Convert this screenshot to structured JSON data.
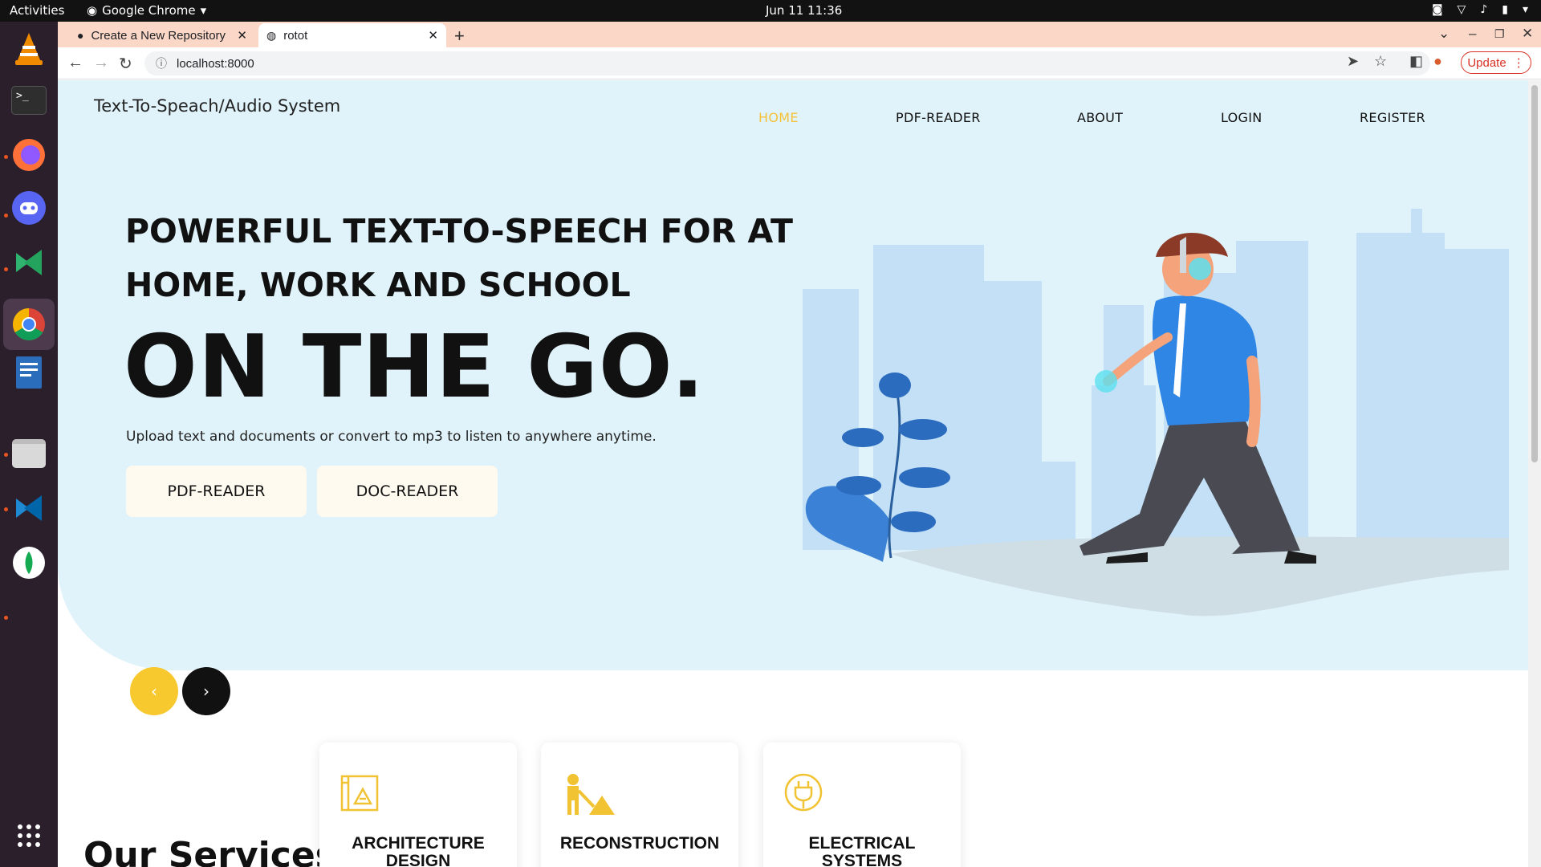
{
  "system": {
    "activities": "Activities",
    "app_menu": "Google Chrome",
    "clock": "Jun 11  11:36"
  },
  "browser": {
    "tabs": [
      {
        "title": "Create a New Repository",
        "favicon": "github-icon"
      },
      {
        "title": "rotot",
        "favicon": "globe-icon"
      }
    ],
    "url": "localhost:8000",
    "update_label": "Update"
  },
  "site": {
    "brand": "Text-To-Speach/Audio System",
    "nav": [
      "HOME",
      "PDF-READER",
      "ABOUT",
      "LOGIN",
      "REGISTER"
    ],
    "hero": {
      "headline_line1": "POWERFUL TEXT-TO-SPEECH FOR AT",
      "headline_line2": "HOME, WORK AND SCHOOL",
      "big": "ON THE GO.",
      "subtitle": "Upload text and documents or convert to mp3 to listen to anywhere anytime.",
      "buttons": [
        "PDF-READER",
        "DOC-READER"
      ]
    },
    "slider": {
      "prev": "‹",
      "next": "›"
    },
    "services_title": "Our Services",
    "services": [
      {
        "title_line1": "ARCHITECTURE",
        "title_line2": "DESIGN",
        "icon": "blueprint-icon"
      },
      {
        "title_line1": "RECONSTRUCTION",
        "title_line2": "",
        "icon": "worker-icon"
      },
      {
        "title_line1": "ELECTRICAL",
        "title_line2": "SYSTEMS",
        "icon": "plug-icon"
      }
    ]
  },
  "colors": {
    "hero_bg": "#e0f3fa",
    "accent_yellow": "#f5c33b",
    "chrome_tabstrip": "#fbd7c8",
    "update_red": "#d93025"
  }
}
